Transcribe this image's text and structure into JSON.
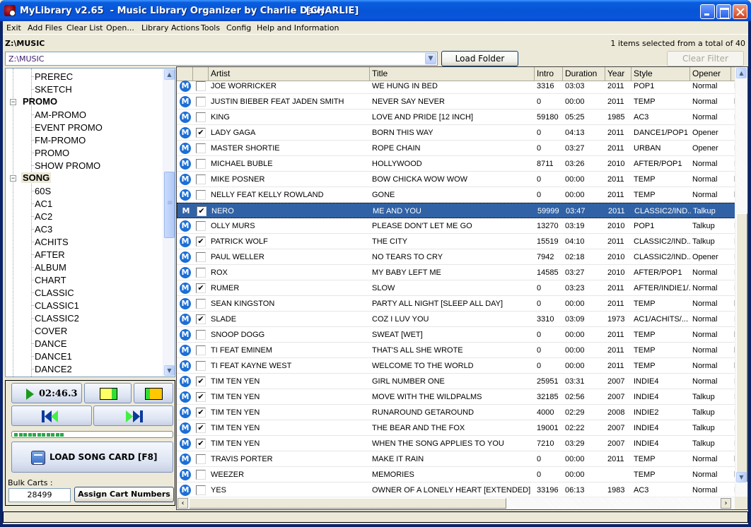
{
  "window": {
    "title": "MyLibrary v2.65  - Music Library Organizer by Charlie Davy",
    "user": "[CHARLIE]"
  },
  "menu": [
    "Exit",
    "Add Files",
    "Clear List",
    "Open...",
    "Library Actions",
    "Tools",
    "Config",
    "Help and Information"
  ],
  "path_label": "Z:\\MUSIC",
  "selection_status": "1 items selected from a total of 40",
  "path_combo": {
    "value": "Z:\\MUSIC"
  },
  "buttons": {
    "load_folder": "Load Folder",
    "clear_filter": "Clear Filter"
  },
  "tree": [
    {
      "label": "PREREC",
      "level": "child"
    },
    {
      "label": "SKETCH",
      "level": "child"
    },
    {
      "label": "PROMO",
      "level": "parent",
      "expanded": true
    },
    {
      "label": "AM-PROMO",
      "level": "child"
    },
    {
      "label": "EVENT PROMO",
      "level": "child"
    },
    {
      "label": "FM-PROMO",
      "level": "child"
    },
    {
      "label": "PROMO",
      "level": "child"
    },
    {
      "label": "SHOW PROMO",
      "level": "child"
    },
    {
      "label": "SONG",
      "level": "parent",
      "expanded": true,
      "selected": true
    },
    {
      "label": "60S",
      "level": "child"
    },
    {
      "label": "AC1",
      "level": "child"
    },
    {
      "label": "AC2",
      "level": "child"
    },
    {
      "label": "AC3",
      "level": "child"
    },
    {
      "label": "ACHITS",
      "level": "child"
    },
    {
      "label": "AFTER",
      "level": "child"
    },
    {
      "label": "ALBUM",
      "level": "child"
    },
    {
      "label": "CHART",
      "level": "child"
    },
    {
      "label": "CLASSIC",
      "level": "child"
    },
    {
      "label": "CLASSIC1",
      "level": "child"
    },
    {
      "label": "CLASSIC2",
      "level": "child"
    },
    {
      "label": "COVER",
      "level": "child"
    },
    {
      "label": "DANCE",
      "level": "child"
    },
    {
      "label": "DANCE1",
      "level": "child"
    },
    {
      "label": "DANCE2",
      "level": "child"
    }
  ],
  "player": {
    "time": "02:46.3",
    "progress_segments": 11,
    "load_song_card": "LOAD SONG CARD  [F8]",
    "bulk_carts_label": "Bulk Carts :",
    "bulk_carts_value": "28499",
    "assign_cart_numbers": "Assign Cart Numbers",
    "cue_colors": {
      "yellow": "#FFFF66",
      "green": "#33DD33",
      "orange": "#FFC800"
    }
  },
  "grid": {
    "columns": [
      "",
      "",
      "Artist",
      "Title",
      "Intro",
      "Duration",
      "Year",
      "Style",
      "Opener",
      ""
    ],
    "row_icon": "M",
    "rows": [
      {
        "checked": false,
        "artist": "JOE WORRICKER",
        "title": "WE HUNG IN BED",
        "intro": "3316",
        "duration": "03:03",
        "year": "2011",
        "style": "POP1",
        "opener": "Normal",
        "extra": "E"
      },
      {
        "checked": false,
        "artist": "JUSTIN BIEBER FEAT JADEN SMITH",
        "title": "NEVER SAY NEVER",
        "intro": "0",
        "duration": "00:00",
        "year": "2011",
        "style": "TEMP",
        "opener": "Normal",
        "extra": "b"
      },
      {
        "checked": false,
        "artist": "KING",
        "title": "LOVE AND PRIDE [12 INCH]",
        "intro": "59180",
        "duration": "05:25",
        "year": "1985",
        "style": "AC3",
        "opener": "Normal",
        "extra": "E"
      },
      {
        "checked": true,
        "artist": "LADY GAGA",
        "title": "BORN THIS WAY",
        "intro": "0",
        "duration": "04:13",
        "year": "2011",
        "style": "DANCE1/POP1",
        "opener": "Opener",
        "extra": "E"
      },
      {
        "checked": false,
        "artist": "MASTER SHORTIE",
        "title": "ROPE CHAIN",
        "intro": "0",
        "duration": "03:27",
        "year": "2011",
        "style": "URBAN",
        "opener": "Opener",
        "extra": "E"
      },
      {
        "checked": false,
        "artist": "MICHAEL BUBLE",
        "title": "HOLLYWOOD",
        "intro": "8711",
        "duration": "03:26",
        "year": "2010",
        "style": "AFTER/POP1",
        "opener": "Normal",
        "extra": "F"
      },
      {
        "checked": false,
        "artist": "MIKE POSNER",
        "title": "BOW CHICKA WOW WOW",
        "intro": "0",
        "duration": "00:00",
        "year": "2011",
        "style": "TEMP",
        "opener": "Normal",
        "extra": "b"
      },
      {
        "checked": false,
        "artist": "NELLY FEAT KELLY ROWLAND",
        "title": "GONE",
        "intro": "0",
        "duration": "00:00",
        "year": "2011",
        "style": "TEMP",
        "opener": "Normal",
        "extra": "b"
      },
      {
        "checked": true,
        "selected": true,
        "artist": "NERO",
        "title": "ME AND YOU",
        "intro": "59999",
        "duration": "03:47",
        "year": "2011",
        "style": "CLASSIC2/IND...",
        "opener": "Talkup",
        "extra": "E"
      },
      {
        "checked": false,
        "artist": "OLLY MURS",
        "title": "PLEASE DON'T LET ME GO",
        "intro": "13270",
        "duration": "03:19",
        "year": "2010",
        "style": "POP1",
        "opener": "Talkup",
        "extra": "E"
      },
      {
        "checked": true,
        "artist": "PATRICK WOLF",
        "title": "THE CITY",
        "intro": "15519",
        "duration": "04:10",
        "year": "2011",
        "style": "CLASSIC2/IND...",
        "opener": "Talkup",
        "extra": "E"
      },
      {
        "checked": false,
        "artist": "PAUL WELLER",
        "title": "NO TEARS TO CRY",
        "intro": "7942",
        "duration": "02:18",
        "year": "2010",
        "style": "CLASSIC2/IND...",
        "opener": "Opener",
        "extra": "E"
      },
      {
        "checked": false,
        "artist": "ROX",
        "title": "MY BABY LEFT ME",
        "intro": "14585",
        "duration": "03:27",
        "year": "2010",
        "style": "AFTER/POP1",
        "opener": "Normal",
        "extra": "E"
      },
      {
        "checked": true,
        "artist": "RUMER",
        "title": "SLOW",
        "intro": "0",
        "duration": "03:23",
        "year": "2011",
        "style": "AFTER/INDIE1/...",
        "opener": "Normal",
        "extra": "F"
      },
      {
        "checked": false,
        "artist": "SEAN KINGSTON",
        "title": "PARTY ALL NIGHT [SLEEP ALL DAY]",
        "intro": "0",
        "duration": "00:00",
        "year": "2011",
        "style": "TEMP",
        "opener": "Normal",
        "extra": "b"
      },
      {
        "checked": true,
        "artist": "SLADE",
        "title": "COZ I LUV YOU",
        "intro": "3310",
        "duration": "03:09",
        "year": "1973",
        "style": "AC1/ACHITS/...",
        "opener": "Normal",
        "extra": "F"
      },
      {
        "checked": false,
        "artist": "SNOOP DOGG",
        "title": "SWEAT [WET]",
        "intro": "0",
        "duration": "00:00",
        "year": "2011",
        "style": "TEMP",
        "opener": "Normal",
        "extra": "b"
      },
      {
        "checked": false,
        "artist": "TI FEAT EMINEM",
        "title": "THAT'S ALL SHE WROTE",
        "intro": "0",
        "duration": "00:00",
        "year": "2011",
        "style": "TEMP",
        "opener": "Normal",
        "extra": "b"
      },
      {
        "checked": false,
        "artist": "TI FEAT KAYNE WEST",
        "title": "WELCOME TO THE WORLD",
        "intro": "0",
        "duration": "00:00",
        "year": "2011",
        "style": "TEMP",
        "opener": "Normal",
        "extra": "b"
      },
      {
        "checked": true,
        "artist": "TIM TEN YEN",
        "title": "GIRL NUMBER ONE",
        "intro": "25951",
        "duration": "03:31",
        "year": "2007",
        "style": "INDIE4",
        "opener": "Normal",
        "extra": "E"
      },
      {
        "checked": true,
        "artist": "TIM TEN YEN",
        "title": "MOVE WITH THE WILDPALMS",
        "intro": "32185",
        "duration": "02:56",
        "year": "2007",
        "style": "INDIE4",
        "opener": "Talkup",
        "extra": "E"
      },
      {
        "checked": true,
        "artist": "TIM TEN YEN",
        "title": "RUNAROUND GETAROUND",
        "intro": "4000",
        "duration": "02:29",
        "year": "2008",
        "style": "INDIE2",
        "opener": "Talkup",
        "extra": "E"
      },
      {
        "checked": true,
        "artist": "TIM TEN YEN",
        "title": "THE BEAR AND THE FOX",
        "intro": "19001",
        "duration": "02:22",
        "year": "2007",
        "style": "INDIE4",
        "opener": "Talkup",
        "extra": "E"
      },
      {
        "checked": true,
        "artist": "TIM TEN YEN",
        "title": "WHEN THE SONG APPLIES TO YOU",
        "intro": "7210",
        "duration": "03:29",
        "year": "2007",
        "style": "INDIE4",
        "opener": "Talkup",
        "extra": "E"
      },
      {
        "checked": false,
        "artist": "TRAVIS PORTER",
        "title": "MAKE IT RAIN",
        "intro": "0",
        "duration": "00:00",
        "year": "2011",
        "style": "TEMP",
        "opener": "Normal",
        "extra": "b"
      },
      {
        "checked": false,
        "artist": "WEEZER",
        "title": "MEMORIES",
        "intro": "0",
        "duration": "00:00",
        "year": "",
        "style": "TEMP",
        "opener": "Normal",
        "extra": "b"
      },
      {
        "checked": false,
        "artist": "YES",
        "title": "OWNER OF A LONELY HEART [EXTENDED]",
        "intro": "33196",
        "duration": "06:13",
        "year": "1983",
        "style": "AC3",
        "opener": "Normal",
        "extra": "F"
      }
    ]
  },
  "colors": {
    "selection": "#3162A6",
    "titlebar": "#0754D6",
    "row_icon": "#1C6FD6"
  }
}
